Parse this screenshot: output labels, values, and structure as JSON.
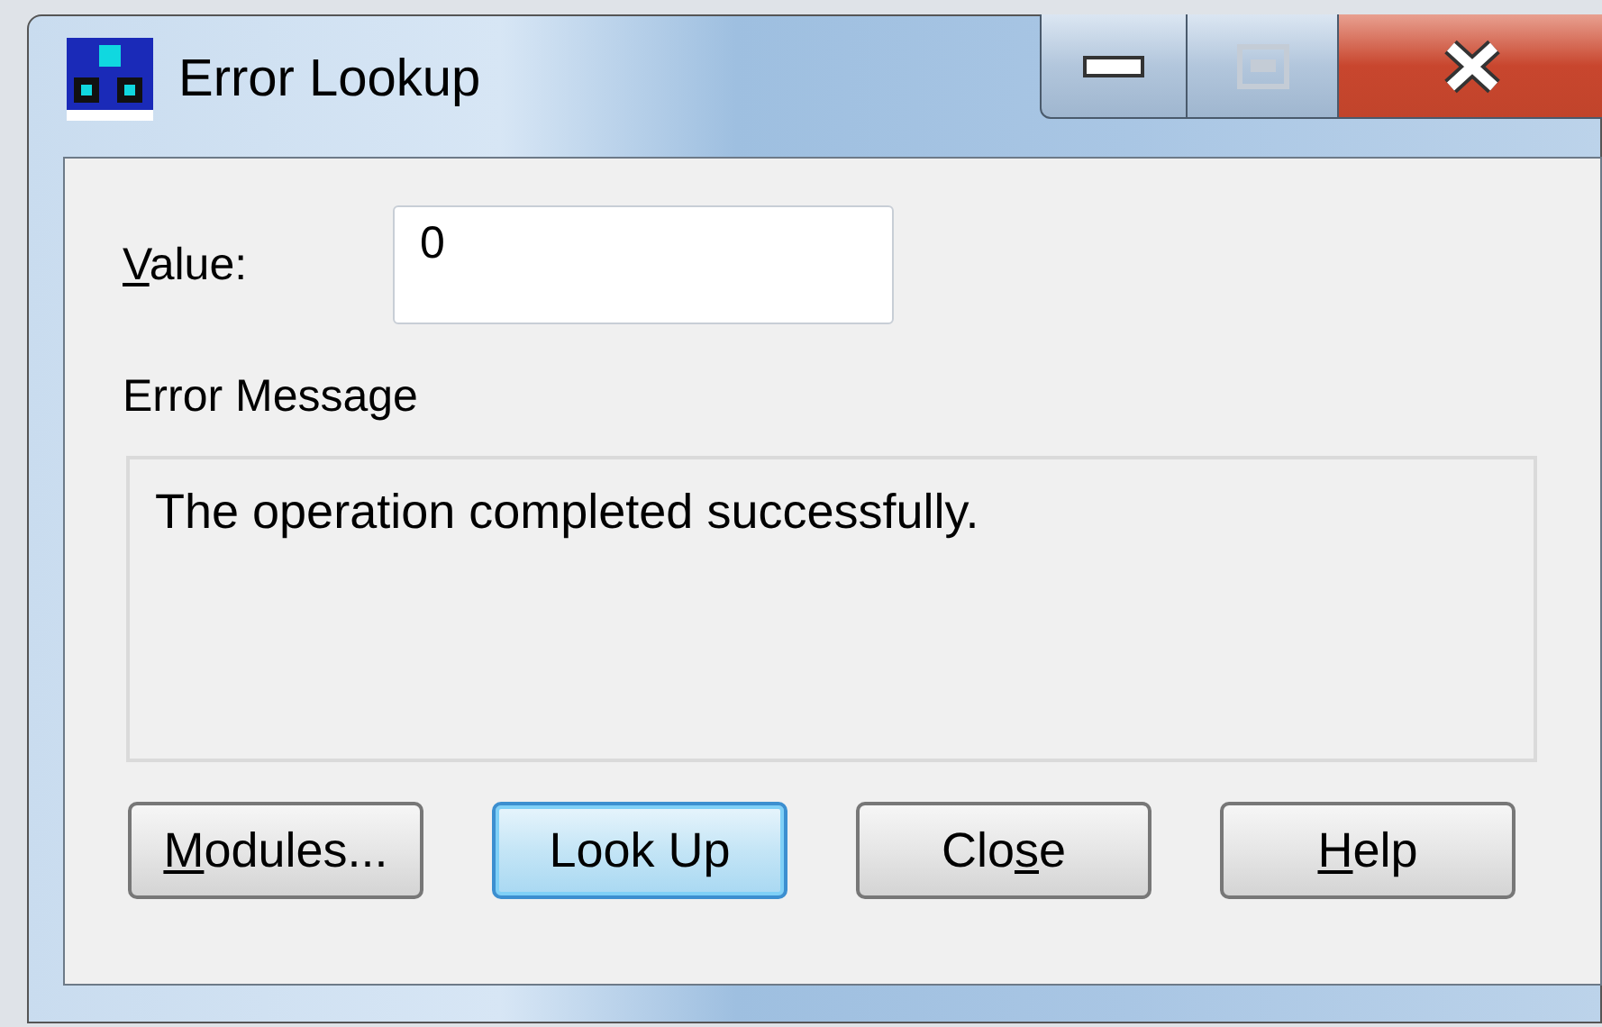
{
  "window": {
    "title": "Error Lookup"
  },
  "value_field": {
    "label": {
      "key": "V",
      "post": "alue:"
    },
    "value": "0"
  },
  "message": {
    "label": "Error Message",
    "text": "The operation completed successfully."
  },
  "buttons": [
    {
      "key": "M",
      "post": "odules...",
      "default": false
    },
    {
      "pre": "Look Up",
      "default": true
    },
    {
      "pre": "Clo",
      "key": "s",
      "post": "e",
      "default": false
    },
    {
      "key": "H",
      "post": "elp",
      "default": false
    }
  ]
}
